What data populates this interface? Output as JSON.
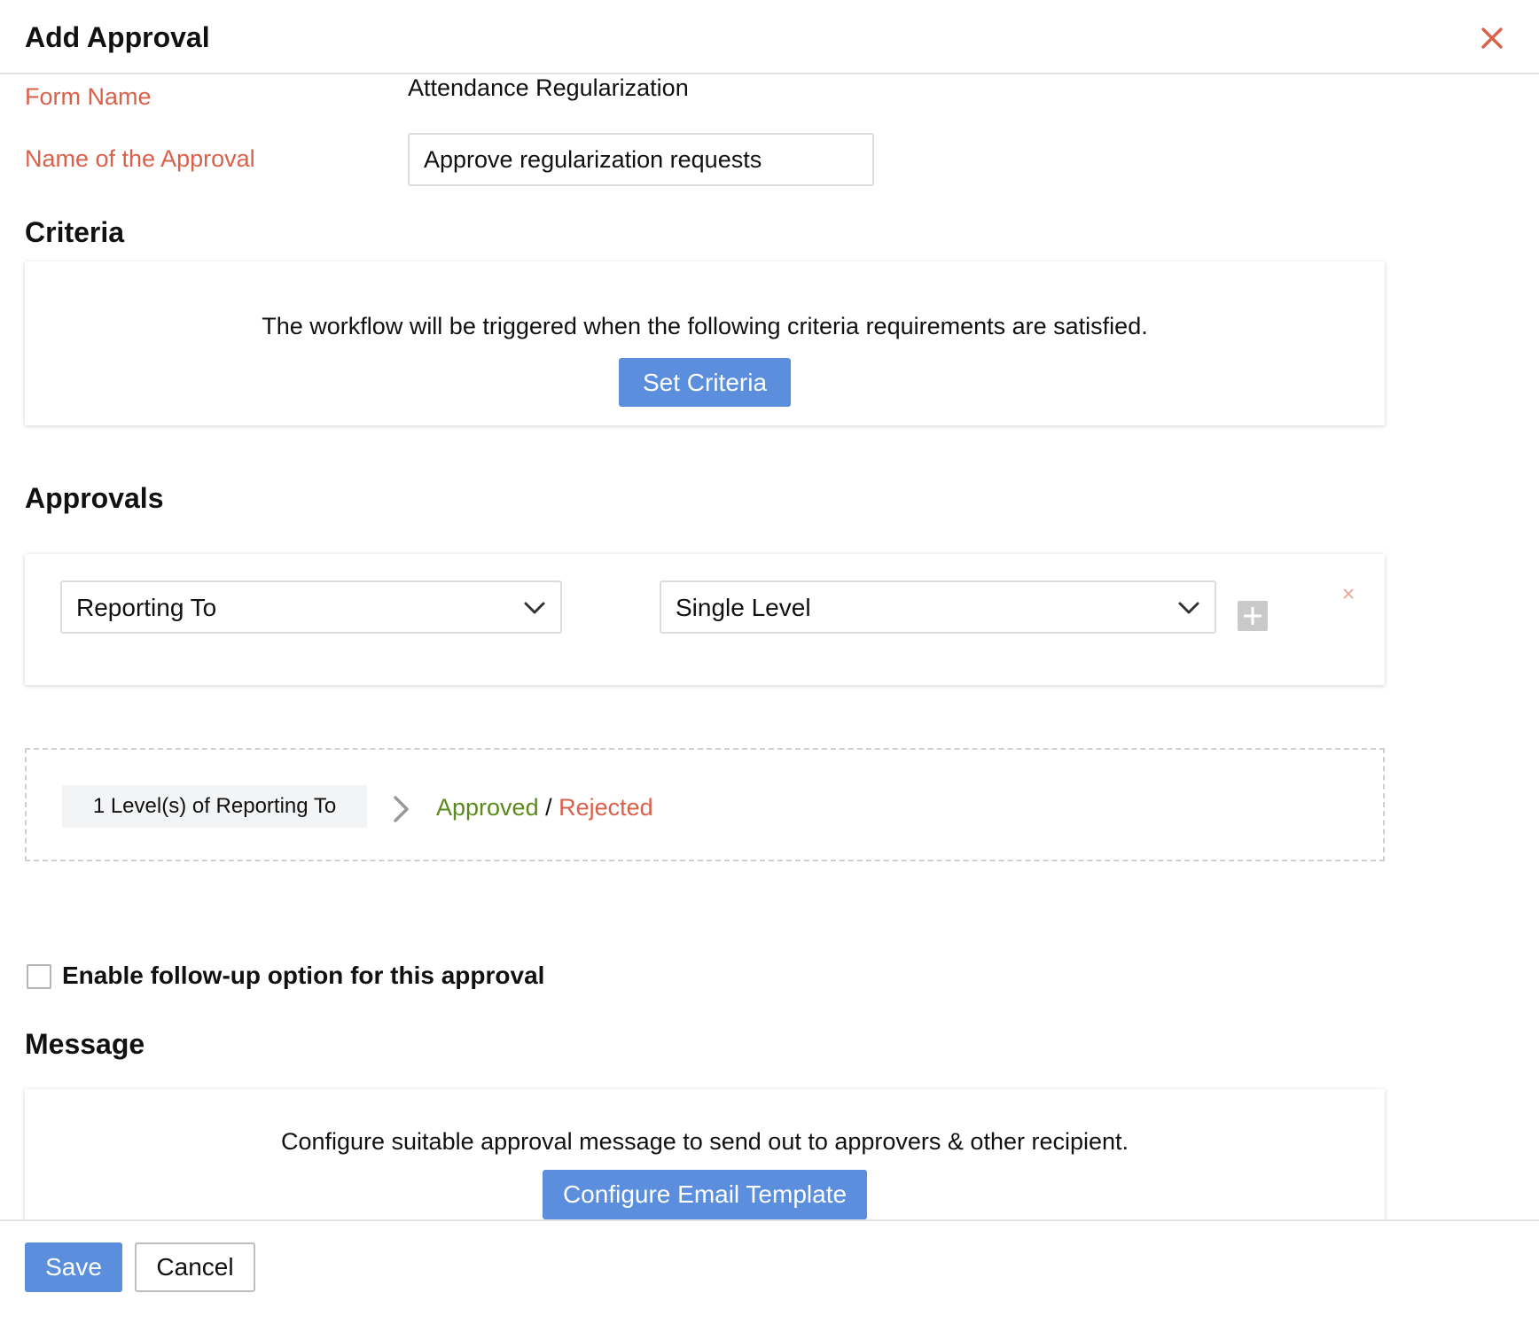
{
  "header": {
    "title": "Add Approval"
  },
  "form": {
    "form_name_label": "Form Name",
    "form_name_value": "Attendance Regularization",
    "approval_name_label": "Name of the Approval",
    "approval_name_value": "Approve regularization requests"
  },
  "criteria": {
    "title": "Criteria",
    "description": "The workflow will be triggered when the following criteria requirements are satisfied.",
    "button_label": "Set Criteria"
  },
  "approvals": {
    "title": "Approvals",
    "approver_type": "Reporting To",
    "level_type": "Single Level"
  },
  "flow": {
    "level_summary": "1 Level(s) of Reporting To",
    "approved_label": "Approved",
    "separator": " / ",
    "rejected_label": "Rejected"
  },
  "follow_up": {
    "checked": false,
    "label": "Enable follow-up option for this approval"
  },
  "message": {
    "title": "Message",
    "description": "Configure suitable approval message to send out to approvers & other recipient.",
    "button_label": "Configure Email Template"
  },
  "footer": {
    "save_label": "Save",
    "cancel_label": "Cancel"
  },
  "colors": {
    "accent_blue": "#5b8fde",
    "label_red": "#d9614a",
    "approved_green": "#5a8a1c"
  },
  "icons": {
    "close": "close-icon",
    "dropdown": "chevron-down-icon",
    "add": "plus-icon",
    "remove": "close-icon",
    "flow": "chevron-right-icon"
  }
}
